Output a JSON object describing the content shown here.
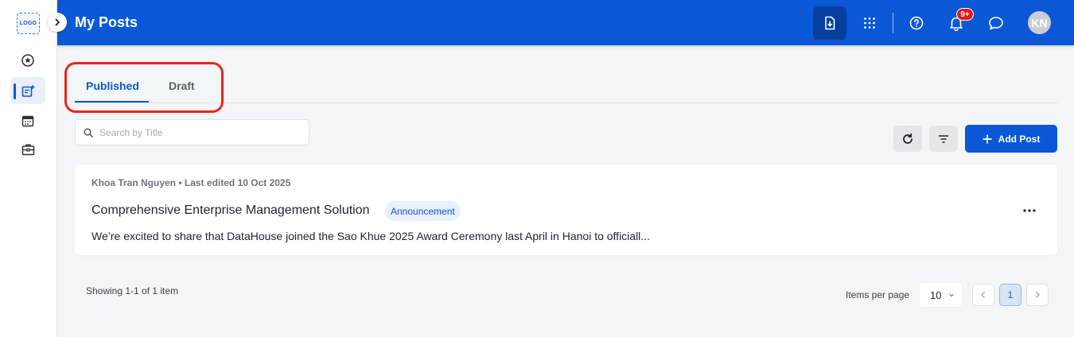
{
  "sidebar": {
    "logo_text": "LOGO",
    "items": [
      {
        "name": "favorites",
        "icon": "star-circle-icon"
      },
      {
        "name": "posts",
        "icon": "edit-post-icon",
        "active": true
      },
      {
        "name": "calendar",
        "icon": "calendar-icon"
      },
      {
        "name": "toolbox",
        "icon": "briefcase-icon"
      }
    ]
  },
  "header": {
    "title": "My Posts",
    "avatar_initials": "KN",
    "notification_badge": "9+",
    "icons": [
      "download-icon",
      "apps-grid-icon",
      "help-icon",
      "bell-icon",
      "chat-icon"
    ]
  },
  "tabs": [
    {
      "label": "Published",
      "active": true
    },
    {
      "label": "Draft",
      "active": false
    }
  ],
  "search": {
    "placeholder": "Search by Title",
    "value": ""
  },
  "actions": {
    "add_label": "Add Post"
  },
  "posts": [
    {
      "meta": "Khoa Tran Nguyen • Last edited 10 Oct 2025",
      "title": "Comprehensive Enterprise Management Solution",
      "tag": "Announcement",
      "excerpt": "We’re excited to share that DataHouse joined the Sao Khue 2025 Award Ceremony last April in Hanoi to officiall..."
    }
  ],
  "footer": {
    "showing_text": "Showing 1-1 of 1 item",
    "items_per_page_label": "Items per page",
    "items_per_page_value": "10",
    "current_page": "1"
  },
  "colors": {
    "primary": "#0a58d6",
    "header_active": "#063f9e",
    "badge": "#e01b1b",
    "highlight": "#e8261c"
  }
}
